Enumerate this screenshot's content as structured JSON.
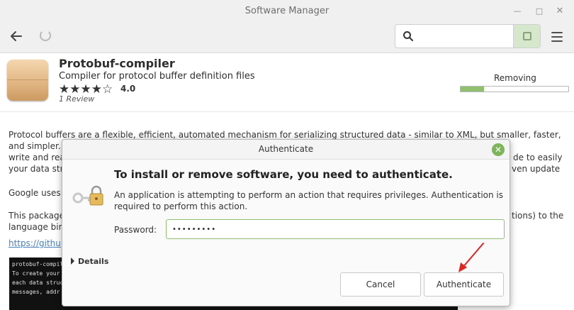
{
  "window": {
    "title": "Software Manager"
  },
  "toolbar": {
    "search": {
      "placeholder": "",
      "value": ""
    }
  },
  "package": {
    "name": "Protobuf-compiler",
    "summary": "Compiler for protocol buffer definition files",
    "stars": "★★★★☆",
    "rating": "4.0",
    "reviews": "1 Review",
    "status": "Removing",
    "progress": 0.22
  },
  "description": {
    "lines": [
      "Protocol buffers are a flexible, efficient, automated mechanism for serializing structured data - similar to XML, but smaller, faster,",
      "and simpler.",
      "write and rea",
      "your data str",
      "Google uses",
      "This package",
      "language bir"
    ],
    "right_fragments": [
      "de to easily",
      "ven update",
      "tions) to the"
    ],
    "link": "https://githu"
  },
  "terminal": {
    "lines": [
      "protobuf-compile",
      "To create your ac",
      "each data structu",
      "messages, addr"
    ]
  },
  "dialog": {
    "title": "Authenticate",
    "heading": "To install or remove software, you need to authenticate.",
    "message": "An application is attempting to perform an action that requires privileges. Authentication is required to perform this action.",
    "password_label": "Password:",
    "password_value": "•••••••••",
    "details_label": "Details",
    "cancel_label": "Cancel",
    "authenticate_label": "Authenticate"
  },
  "colors": {
    "accent_green": "#8fbf6f",
    "close_green": "#7db55c",
    "annotation_red": "#e0241f"
  }
}
